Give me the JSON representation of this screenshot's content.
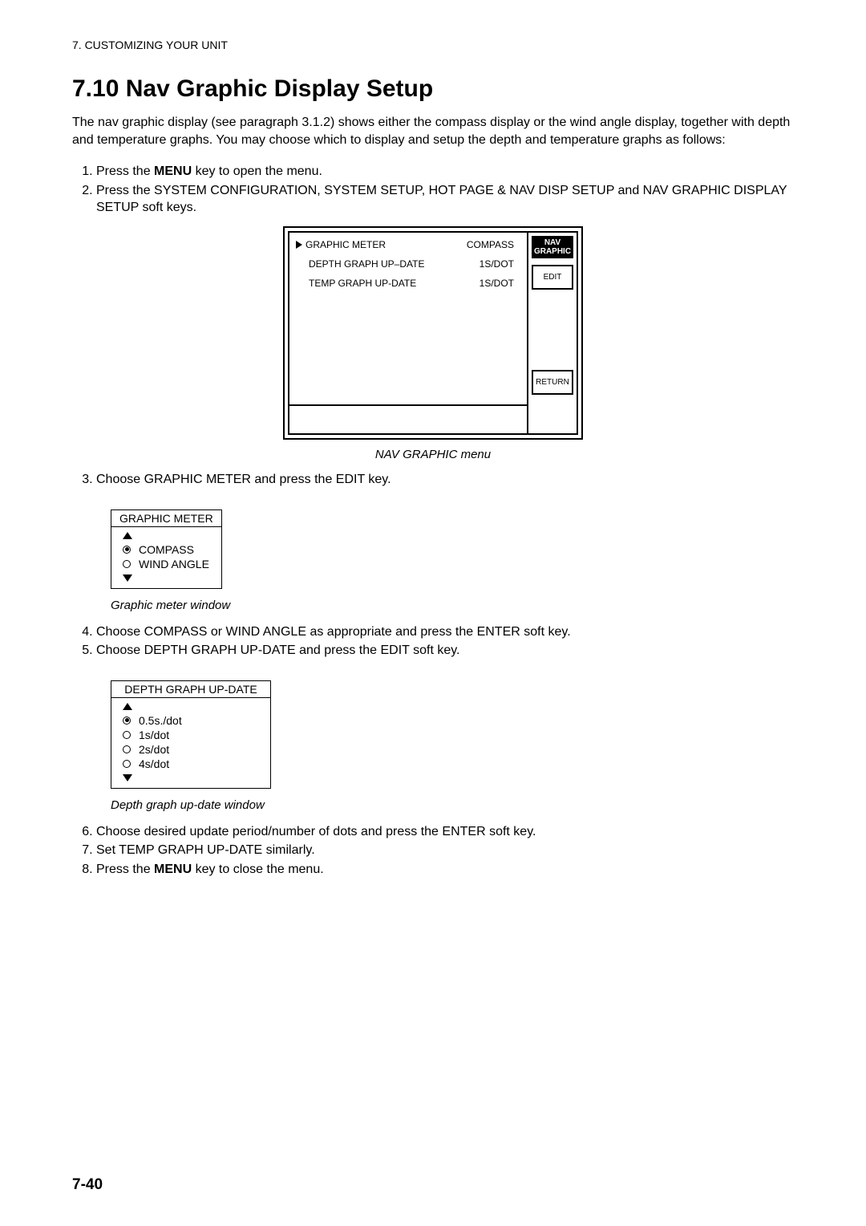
{
  "running_head": "7. CUSTOMIZING YOUR UNIT",
  "heading": "7.10  Nav Graphic Display Setup",
  "intro": "The nav graphic display (see paragraph 3.1.2) shows either the compass display or the wind angle display, together with depth and temperature graphs. You may choose which to display and setup the depth and temperature graphs as follows:",
  "steps_a": [
    {
      "pre": "Press the ",
      "bold": "MENU",
      "post": " key to open the menu."
    },
    {
      "pre": "Press the SYSTEM CONFIGURATION, SYSTEM SETUP, HOT PAGE & NAV DISP SETUP and NAV GRAPHIC DISPLAY SETUP soft keys.",
      "bold": "",
      "post": ""
    }
  ],
  "nav_menu": {
    "rows": [
      {
        "label": "GRAPHIC METER",
        "value": "COMPASS",
        "arrow": true
      },
      {
        "label": "DEPTH GRAPH UP–DATE",
        "value": "1S/DOT",
        "arrow": false
      },
      {
        "label": "TEMP GRAPH UP-DATE",
        "value": "1S/DOT",
        "arrow": false
      }
    ],
    "softkeys": {
      "title_line1": "NAV",
      "title_line2": "GRAPHIC",
      "edit": "EDIT",
      "return": "RETURN"
    },
    "caption": "NAV GRAPHIC menu"
  },
  "step3": "Choose GRAPHIC METER and press the EDIT key.",
  "graphic_meter_window": {
    "title": "GRAPHIC METER",
    "options": [
      {
        "label": "COMPASS",
        "selected": true
      },
      {
        "label": "WIND ANGLE",
        "selected": false
      }
    ],
    "caption": "Graphic meter window"
  },
  "step4": "Choose COMPASS or WIND ANGLE as appropriate and press the ENTER soft key.",
  "step5": "Choose DEPTH GRAPH UP-DATE and press the EDIT soft key.",
  "depth_window": {
    "title": "DEPTH GRAPH UP-DATE",
    "options": [
      {
        "label": "0.5s./dot",
        "selected": true
      },
      {
        "label": "1s/dot",
        "selected": false
      },
      {
        "label": "2s/dot",
        "selected": false
      },
      {
        "label": "4s/dot",
        "selected": false
      }
    ],
    "caption": "Depth graph up-date window"
  },
  "step6": "Choose desired update period/number of dots and press the ENTER soft key.",
  "step7": "Set TEMP GRAPH UP-DATE similarly.",
  "step8": {
    "pre": "Press the ",
    "bold": "MENU",
    "post": " key to close the menu."
  },
  "page_number": "7-40"
}
